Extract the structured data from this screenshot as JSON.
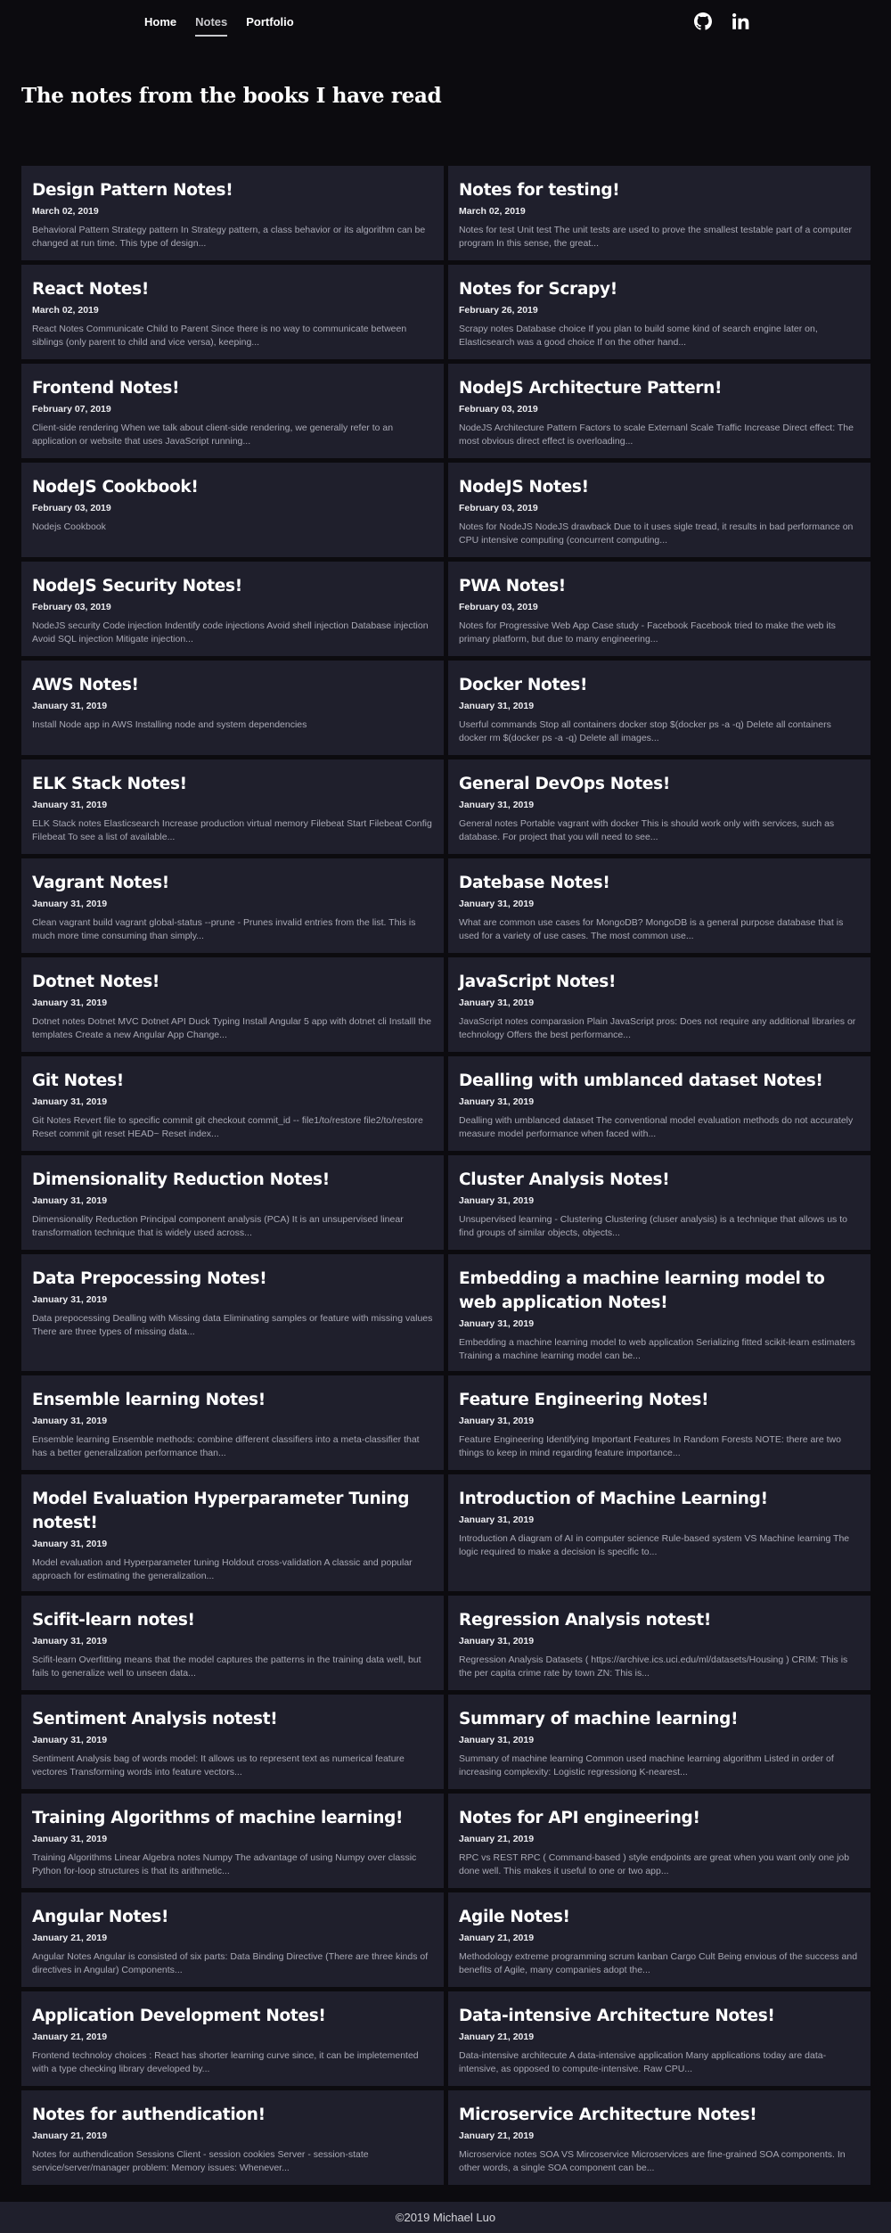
{
  "nav": {
    "links": [
      {
        "label": "Home",
        "active": false
      },
      {
        "label": "Notes",
        "active": true
      },
      {
        "label": "Portfolio",
        "active": false
      }
    ],
    "icons": [
      "github-icon",
      "linkedin-icon"
    ]
  },
  "page": {
    "title": "The notes from the books I have read"
  },
  "notes": [
    {
      "title": "Design Pattern Notes!",
      "date": "March 02, 2019",
      "excerpt": "Behavioral Pattern Strategy pattern In Strategy pattern, a class behavior or its algorithm can be changed at run time. This type of design..."
    },
    {
      "title": "Notes for testing!",
      "date": "March 02, 2019",
      "excerpt": "Notes for test Unit test The unit tests are used to prove the smallest testable part of a computer program In this sense, the great..."
    },
    {
      "title": "React Notes!",
      "date": "March 02, 2019",
      "excerpt": "React Notes Communicate Child to Parent Since there is no way to communicate between siblings (only parent to child and vice versa), keeping..."
    },
    {
      "title": "Notes for Scrapy!",
      "date": "February 26, 2019",
      "excerpt": "Scrapy notes Database choice If you plan to build some kind of search engine later on, Elasticsearch was a good choice If on the other hand..."
    },
    {
      "title": "Frontend Notes!",
      "date": "February 07, 2019",
      "excerpt": "Client-side rendering When we talk about client-side rendering, we generally refer to an application or website that uses JavaScript running..."
    },
    {
      "title": "NodeJS Architecture Pattern!",
      "date": "February 03, 2019",
      "excerpt": "NodeJS Architecture Pattern Factors to scale Externanl Scale Traffic Increase Direct effect: The most obvious direct effect is overloading..."
    },
    {
      "title": "NodeJS Cookbook!",
      "date": "February 03, 2019",
      "excerpt": "Nodejs Cookbook"
    },
    {
      "title": "NodeJS Notes!",
      "date": "February 03, 2019",
      "excerpt": "Notes for NodeJS NodeJS drawback Due to it uses sigle tread, it results in bad performance on CPU intensive computing (concurrent computing..."
    },
    {
      "title": "NodeJS Security Notes!",
      "date": "February 03, 2019",
      "excerpt": "NodeJS security Code injection Indentify code injections Avoid shell injection Database injection Avoid SQL injection Mitigate injection..."
    },
    {
      "title": "PWA Notes!",
      "date": "February 03, 2019",
      "excerpt": "Notes for Progressive Web App Case study - Facebook Facebook tried to make the web its primary platform, but due to many engineering..."
    },
    {
      "title": "AWS Notes!",
      "date": "January 31, 2019",
      "excerpt": "Install Node app in AWS Installing node and system dependencies"
    },
    {
      "title": "Docker Notes!",
      "date": "January 31, 2019",
      "excerpt": "Userful commands Stop all containers docker stop $(docker ps -a -q) Delete all containers docker rm $(docker ps -a -q) Delete all images..."
    },
    {
      "title": "ELK Stack Notes!",
      "date": "January 31, 2019",
      "excerpt": "ELK Stack notes Elasticsearch Increase production virtual memory Filebeat Start Filebeat Config Filebeat To see a list of available..."
    },
    {
      "title": "General DevOps Notes!",
      "date": "January 31, 2019",
      "excerpt": "General notes Portable vagrant with docker This is should work only with services, such as database. For project that you will need to see..."
    },
    {
      "title": "Vagrant Notes!",
      "date": "January 31, 2019",
      "excerpt": "Clean vagrant build vagrant global-status --prune - Prunes invalid entries from the list. This is much more time consuming than simply..."
    },
    {
      "title": "Datebase Notes!",
      "date": "January 31, 2019",
      "excerpt": "What are common use cases for MongoDB? MongoDB is a general purpose database that is used for a variety of use cases. The most common use..."
    },
    {
      "title": "Dotnet Notes!",
      "date": "January 31, 2019",
      "excerpt": "Dotnet notes Dotnet MVC Dotnet API Duck Typing Install Angular 5 app with dotnet cli Installl the templates Create a new Angular App Change..."
    },
    {
      "title": "JavaScript Notes!",
      "date": "January 31, 2019",
      "excerpt": "JavaScript notes comparasion Plain JavaScript pros: Does not require any additional libraries or technology Offers the best performance..."
    },
    {
      "title": "Git Notes!",
      "date": "January 31, 2019",
      "excerpt": "Git Notes Revert file to specific commit git checkout commit_id -- file1/to/restore file2/to/restore Reset commit git reset HEAD~ Reset index..."
    },
    {
      "title": "Dealling with umblanced dataset Notes!",
      "date": "January 31, 2019",
      "excerpt": "Dealling with umblanced dataset The conventional model evaluation methods do not accurately measure model performance when faced with..."
    },
    {
      "title": "Dimensionality Reduction Notes!",
      "date": "January 31, 2019",
      "excerpt": "Dimensionality Reduction Principal component analysis (PCA) It is an unsupervised linear transformation technique that is widely used across..."
    },
    {
      "title": "Cluster Analysis Notes!",
      "date": "January 31, 2019",
      "excerpt": "Unsupervised learning - Clustering Clustering (cluser analysis) is a technique that allows us to find groups of similar objects, objects..."
    },
    {
      "title": "Data Prepocessing Notes!",
      "date": "January 31, 2019",
      "excerpt": "Data prepocessing Dealling with Missing data Eliminating samples or feature with missing values There are three types of missing data..."
    },
    {
      "title": "Embedding a machine learning model to web application Notes!",
      "date": "January 31, 2019",
      "excerpt": "Embedding a machine learning model to web application Serializing fitted scikit-learn estimaters Training a machine learning model can be..."
    },
    {
      "title": "Ensemble learning Notes!",
      "date": "January 31, 2019",
      "excerpt": "Ensemble learning Ensemble methods: combine different classifiers into a meta-classifier that has a better generalization performance than..."
    },
    {
      "title": "Feature Engineering Notes!",
      "date": "January 31, 2019",
      "excerpt": "Feature Engineering Identifying Important Features In Random Forests NOTE: there are two things to keep in mind regarding feature importance..."
    },
    {
      "title": "Model Evaluation Hyperparameter Tuning notest!",
      "date": "January 31, 2019",
      "excerpt": "Model evaluation and Hyperparameter tuning Holdout cross-validation A classic and popular approach for estimating the generalization..."
    },
    {
      "title": "Introduction of Machine Learning!",
      "date": "January 31, 2019",
      "excerpt": "Introduction A diagram of AI in computer science Rule-based system VS Machine learning The logic required to make a decision is specific to..."
    },
    {
      "title": "Scifit-learn notes!",
      "date": "January 31, 2019",
      "excerpt": "Scifit-learn Overfitting means that the model captures the patterns in the training data well, but fails to generalize well to unseen data..."
    },
    {
      "title": "Regression Analysis notest!",
      "date": "January 31, 2019",
      "excerpt": "Regression Analysis Datasets ( https://archive.ics.uci.edu/ml/datasets/Housing ) CRIM: This is the per capita crime rate by town ZN: This is..."
    },
    {
      "title": "Sentiment Analysis notest!",
      "date": "January 31, 2019",
      "excerpt": "Sentiment Analysis bag of words model: It allows us to represent text as numerical feature vectores Transforming words into feature vectors..."
    },
    {
      "title": "Summary of machine learning!",
      "date": "January 31, 2019",
      "excerpt": "Summary of machine learning Common used machine learning algorithm Listed in order of increasing complexity: Logistic regressiong K-nearest..."
    },
    {
      "title": "Training Algorithms of machine learning!",
      "date": "January 31, 2019",
      "excerpt": "Training Algorithms Linear Algebra notes Numpy The advantage of using Numpy over classic Python for-loop structures is that its arithmetic..."
    },
    {
      "title": "Notes for API engineering!",
      "date": "January 21, 2019",
      "excerpt": "RPC vs REST RPC ( Command-based ) style endpoints are great when you want only one job done well. This makes it useful to one or two app..."
    },
    {
      "title": "Angular Notes!",
      "date": "January 21, 2019",
      "excerpt": "Angular Notes Angular is consisted of six parts: Data Binding Directive (There are three kinds of directives in Angular) Components..."
    },
    {
      "title": "Agile Notes!",
      "date": "January 21, 2019",
      "excerpt": "Methodology extreme programming scrum kanban Cargo Cult Being envious of the success and benefits of Agile, many companies adopt the..."
    },
    {
      "title": "Application Development Notes!",
      "date": "January 21, 2019",
      "excerpt": "Frontend technoloy choices : React has shorter learning curve since, it can be impletemented with a type checking library developed by..."
    },
    {
      "title": "Data-intensive Architecture Notes!",
      "date": "January 21, 2019",
      "excerpt": "Data-intensive architecute A data-intensive application Many applications today are data-intensive, as opposed to compute-intensive. Raw CPU..."
    },
    {
      "title": "Notes for authendication!",
      "date": "January 21, 2019",
      "excerpt": "Notes for authendication Sessions Client - session cookies Server - session-state service/server/manager problem: Memory issues: Whenever..."
    },
    {
      "title": "Microservice Architecture Notes!",
      "date": "January 21, 2019",
      "excerpt": "Microservice notes SOA VS Mircoservice Microservices are fine-grained SOA components. In other words, a single SOA component can be..."
    }
  ],
  "footer": {
    "text": "©2019 Michael Luo"
  },
  "colors": {
    "background": "#0c0b0f",
    "card": "#1f1f2c",
    "text": "#ffffff",
    "muted": "#a9a9b5"
  }
}
